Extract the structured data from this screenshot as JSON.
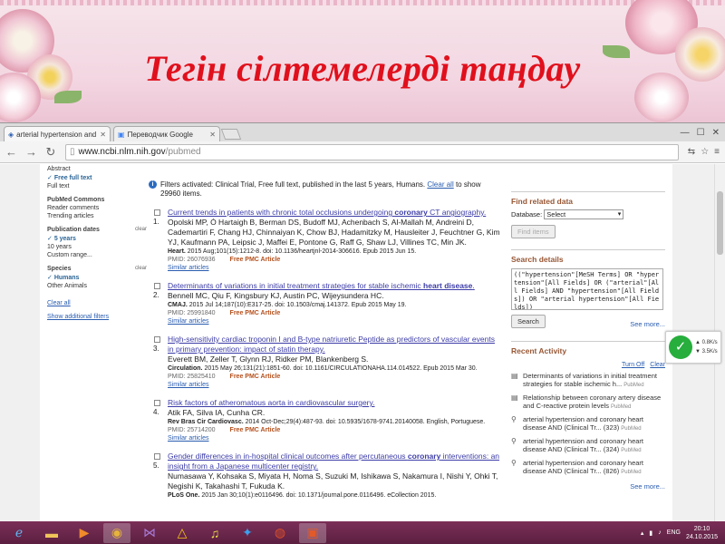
{
  "slide": {
    "title": "Тегін сілтемелерді таңдау"
  },
  "browser": {
    "tabs": [
      {
        "label": "arterial hypertension and",
        "active": true
      },
      {
        "label": "Переводчик Google",
        "active": false
      }
    ],
    "url_host": "www.ncbi.nlm.nih.gov",
    "url_path": "/pubmed"
  },
  "sidebar": {
    "text_avail": [
      "Abstract",
      "Free full text",
      "Full text"
    ],
    "commons_heading": "PubMed Commons",
    "commons_items": [
      "Reader comments",
      "Trending articles"
    ],
    "pubdates_heading": "Publication dates",
    "pubdates_clear": "clear",
    "pubdates_items": [
      "5 years",
      "10 years",
      "Custom range..."
    ],
    "species_heading": "Species",
    "species_clear": "clear",
    "species_items": [
      "Humans",
      "Other Animals"
    ],
    "clear_all": "Clear all",
    "show_additional": "Show additional filters"
  },
  "filters_bar": {
    "label": "Filters activated:",
    "text": "Clinical Trial, Free full text, published in the last 5 years, Humans.",
    "clear_all": "Clear all",
    "tail": "to show 29960 items."
  },
  "results": [
    {
      "num": "1.",
      "title_pre": "Current trends in patients with chronic total occlusions undergoing ",
      "title_bold": "coronary",
      "title_post": " CT angiography.",
      "authors": "Opolski MP, Ó Hartaigh B, Berman DS, Budoff MJ, Achenbach S, Al-Mallah M, Andreini D, Cademartiri F, Chang HJ, Chinnaiyan K, Chow BJ, Hadamitzky M, Hausleiter J, Feuchtner G, Kim YJ, Kaufmann PA, Leipsic J, Maffei E, Pontone G, Raff G, Shaw LJ, Villines TC, Min JK.",
      "journal_b": "Heart.",
      "journal": " 2015 Aug;101(15):1212-8. doi: 10.1136/heartjnl-2014-306616. Epub 2015 Jun 15.",
      "pmid": "PMID: 26076936",
      "free": "Free PMC Article",
      "similar": "Similar articles"
    },
    {
      "num": "2.",
      "title_pre": "Determinants of variations in initial treatment strategies for stable ischemic ",
      "title_bold": "heart disease",
      "title_post": ".",
      "authors": "Bennell MC, Qiu F, Kingsbury KJ, Austin PC, Wijeysundera HC.",
      "journal_b": "CMAJ.",
      "journal": " 2015 Jul 14;187(10):E317-25. doi: 10.1503/cmaj.141372. Epub 2015 May 19.",
      "pmid": "PMID: 25991840",
      "free": "Free PMC Article",
      "similar": "Similar articles"
    },
    {
      "num": "3.",
      "title_pre": "High-sensitivity cardiac troponin I and B-type natriuretic Peptide as predictors of vascular events in primary prevention: impact of statin therapy.",
      "title_bold": "",
      "title_post": "",
      "authors": "Everett BM, Zeller T, Glynn RJ, Ridker PM, Blankenberg S.",
      "journal_b": "Circulation.",
      "journal": " 2015 May 26;131(21):1851-60. doi: 10.1161/CIRCULATIONAHA.114.014522. Epub 2015 Mar 30.",
      "pmid": "PMID: 25825410",
      "free": "Free PMC Article",
      "similar": "Similar articles"
    },
    {
      "num": "4.",
      "title_pre": "Risk factors of atheromatous aorta in cardiovascular surgery.",
      "title_bold": "",
      "title_post": "",
      "authors": "Atik FA, Silva IA, Cunha CR.",
      "journal_b": "Rev Bras Cir Cardiovasc.",
      "journal": " 2014 Oct-Dec;29(4):487-93. doi: 10.5935/1678-9741.20140058. English, Portuguese.",
      "pmid": "PMID: 25714200",
      "free": "Free PMC Article",
      "similar": "Similar articles"
    },
    {
      "num": "5.",
      "title_pre": "Gender differences in in-hospital clinical outcomes after percutaneous ",
      "title_bold": "coronary",
      "title_post": " interventions: an insight from a Japanese multicenter registry.",
      "authors": "Numasawa Y, Kohsaka S, Miyata H, Noma S, Suzuki M, Ishikawa S, Nakamura I, Nishi Y, Ohki T, Negishi K, Takahashi T, Fukuda K.",
      "journal_b": "PLoS One.",
      "journal": " 2015 Jan 30;10(1):e0116496. doi: 10.1371/journal.pone.0116496. eCollection 2015.",
      "pmid": "",
      "free": "",
      "similar": ""
    }
  ],
  "right": {
    "find_related": "Find related data",
    "database_label": "Database:",
    "database_value": "Select",
    "find_items": "Find items",
    "search_details": "Search details",
    "query": "((\"hypertension\"[MeSH Terms] OR \"hypertension\"[All Fields] OR (\"arterial\"[All Fields] AND \"hypertension\"[All Fields]) OR \"arterial hypertension\"[All Fields])",
    "search_btn": "Search",
    "see_more": "See more...",
    "recent_activity": "Recent Activity",
    "turn_off": "Turn Off",
    "clear": "Clear",
    "activity": [
      {
        "icon": "document-icon",
        "text": "Determinants of variations in initial treatment strategies for stable ischemic h...",
        "tag": "PubMed"
      },
      {
        "icon": "document-icon",
        "text": "Relationship between coronary artery disease and C-reactive protein levels",
        "tag": "PubMed"
      },
      {
        "icon": "search-icon",
        "text": "arterial hypertension and coronary heart disease AND (Clinical Tr... (323)",
        "tag": "PubMed"
      },
      {
        "icon": "search-icon",
        "text": "arterial hypertension and coronary heart disease AND (Clinical Tr... (324)",
        "tag": "PubMed"
      },
      {
        "icon": "search-icon",
        "text": "arterial hypertension and coronary heart disease AND (Clinical Tr... (826)",
        "tag": "PubMed"
      }
    ],
    "see_more_2": "See more..."
  },
  "net_widget": {
    "up": "0.8K/s",
    "down": "3.5K/s",
    "check": "✓"
  },
  "taskbar": {
    "lang": "ENG",
    "time": "20:10",
    "date": "24.10.2015"
  },
  "colors": {
    "title_red": "#e0101c",
    "heading_brown": "#985735",
    "link_blue": "#2a5db0",
    "free_orange": "#b5501d",
    "taskbar": "#6b2750"
  }
}
